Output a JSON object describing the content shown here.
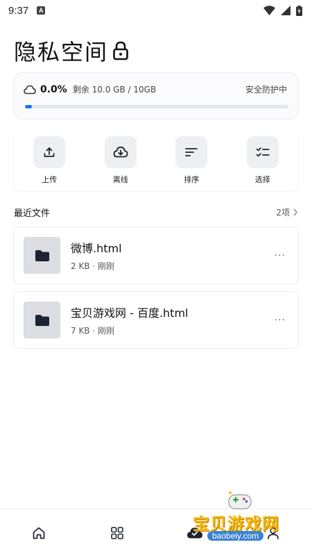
{
  "status_bar": {
    "time": "9:37",
    "notif_letter": "A"
  },
  "page": {
    "title": "隐私空间"
  },
  "storage": {
    "percent": "0.0%",
    "remaining": "剩余 10.0 GB / 10GB",
    "status": "安全防护中",
    "progress": 0.025
  },
  "actions": [
    {
      "label": "上传",
      "icon": "upload-icon"
    },
    {
      "label": "离线",
      "icon": "cloud-download-icon"
    },
    {
      "label": "排序",
      "icon": "sort-icon"
    },
    {
      "label": "选择",
      "icon": "checklist-icon"
    }
  ],
  "recent": {
    "title": "最近文件",
    "count": "2项",
    "files": [
      {
        "name": "微博.html",
        "meta": "2 KB · 刚刚",
        "more": "···"
      },
      {
        "name": "宝贝游戏网 - 百度.html",
        "meta": "7 KB · 刚刚",
        "more": "···"
      }
    ]
  },
  "nav": [
    "home-icon",
    "grid-icon",
    "cloud-check-icon",
    "profile-icon"
  ],
  "watermark": {
    "text": "宝贝游戏网",
    "url": "baobeiy.com"
  },
  "colors": {
    "accent": "#1a73e8",
    "icon_dark": "#1c2433",
    "watermark": "#f7b900"
  }
}
